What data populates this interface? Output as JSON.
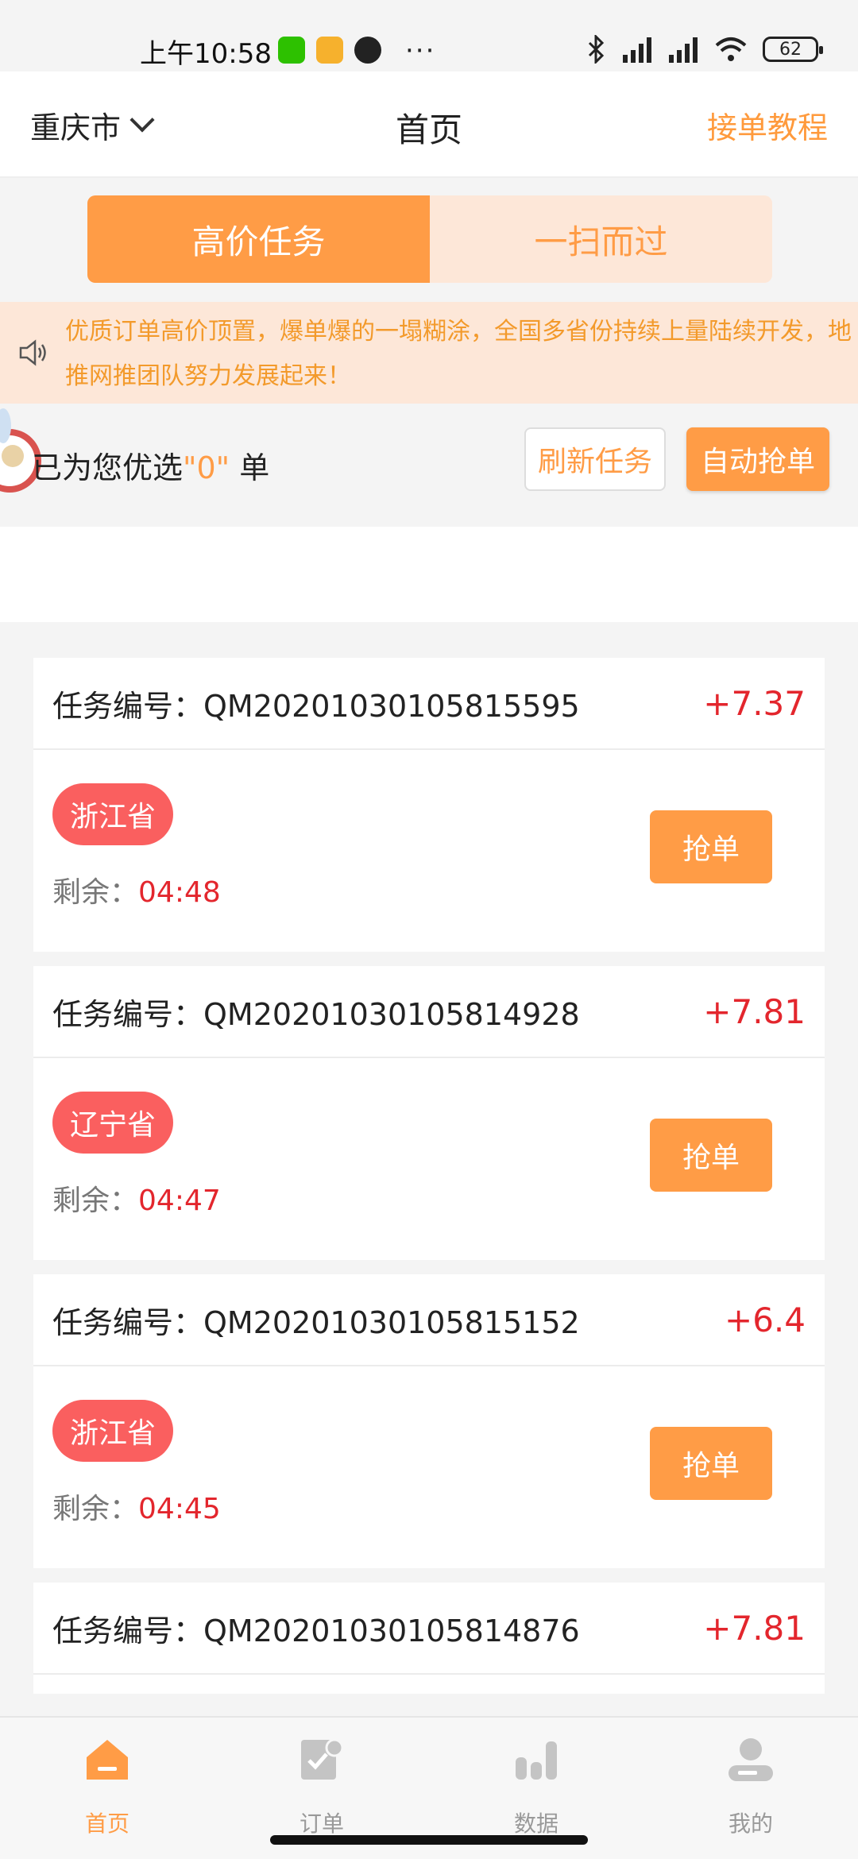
{
  "status_bar": {
    "time": "上午10:58",
    "battery": "62"
  },
  "header": {
    "city": "重庆市",
    "title": "首页",
    "tutorial": "接单教程"
  },
  "tabs": [
    {
      "label": "高价任务",
      "active": true
    },
    {
      "label": "一扫而过",
      "active": false
    }
  ],
  "notice": {
    "text": "优质订单高价顶置，爆单爆的一塌糊涂，全国多省份持续上量陆续开发，地推网推团队努力发展起来！"
  },
  "selection": {
    "prefix": "已为您优选",
    "count": "\"0\"",
    "suffix": " 单",
    "refresh_label": "刷新任务",
    "auto_label": "自动抢单"
  },
  "tasks": [
    {
      "id_label": "任务编号：",
      "id": "QM20201030105815595",
      "price": "+7.37",
      "province": "浙江省",
      "remain_label": "剩余：",
      "remain": "04:48",
      "grab_label": "抢单"
    },
    {
      "id_label": "任务编号：",
      "id": "QM20201030105814928",
      "price": "+7.81",
      "province": "辽宁省",
      "remain_label": "剩余：",
      "remain": "04:47",
      "grab_label": "抢单"
    },
    {
      "id_label": "任务编号：",
      "id": "QM20201030105815152",
      "price": "+6.4",
      "province": "浙江省",
      "remain_label": "剩余：",
      "remain": "04:45",
      "grab_label": "抢单"
    },
    {
      "id_label": "任务编号：",
      "id": "QM20201030105814876",
      "price": "+7.81"
    }
  ],
  "nav": [
    {
      "label": "首页",
      "icon": "home-icon",
      "active": true
    },
    {
      "label": "订单",
      "icon": "orders-icon",
      "active": false
    },
    {
      "label": "数据",
      "icon": "data-icon",
      "active": false
    },
    {
      "label": "我的",
      "icon": "profile-icon",
      "active": false
    }
  ],
  "colors": {
    "accent": "#ff9c46",
    "price": "#e3262d",
    "province_badge": "#fa5f5f",
    "notice_bg": "#fde7d8"
  }
}
